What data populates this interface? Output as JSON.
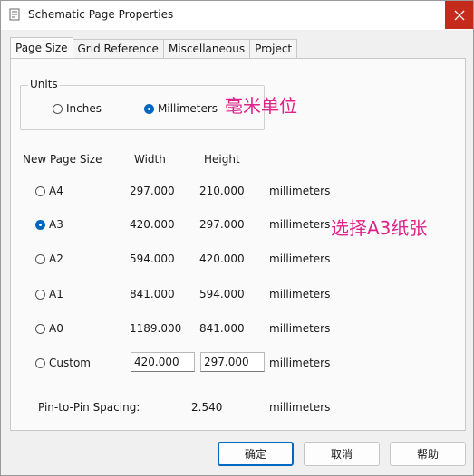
{
  "window": {
    "title": "Schematic Page Properties"
  },
  "tabs": [
    {
      "label": "Page Size",
      "active": true
    },
    {
      "label": "Grid Reference",
      "active": false
    },
    {
      "label": "Miscellaneous",
      "active": false
    },
    {
      "label": "Project",
      "active": false
    }
  ],
  "units": {
    "legend": "Units",
    "inches_label": "Inches",
    "millimeters_label": "Millimeters",
    "selected": "millimeters",
    "annotation": "毫米单位"
  },
  "page_size": {
    "header_label": "New Page Size",
    "width_header": "Width",
    "height_header": "Height",
    "selected": "A3",
    "annotation": "选择A3纸张",
    "rows": [
      {
        "name": "A4",
        "width": "297.000",
        "height": "210.000",
        "unit": "millimeters"
      },
      {
        "name": "A3",
        "width": "420.000",
        "height": "297.000",
        "unit": "millimeters"
      },
      {
        "name": "A2",
        "width": "594.000",
        "height": "420.000",
        "unit": "millimeters"
      },
      {
        "name": "A1",
        "width": "841.000",
        "height": "594.000",
        "unit": "millimeters"
      },
      {
        "name": "A0",
        "width": "1189.000",
        "height": "841.000",
        "unit": "millimeters"
      }
    ],
    "custom": {
      "name": "Custom",
      "width": "420.000",
      "height": "297.000",
      "unit": "millimeters"
    }
  },
  "pin_spacing": {
    "label": "Pin-to-Pin Spacing:",
    "value": "2.540",
    "unit": "millimeters"
  },
  "buttons": {
    "ok": "确定",
    "cancel": "取消",
    "help": "帮助"
  },
  "colors": {
    "accent": "#0067c0",
    "close": "#c42b1c",
    "annotation": "#e0218a"
  }
}
